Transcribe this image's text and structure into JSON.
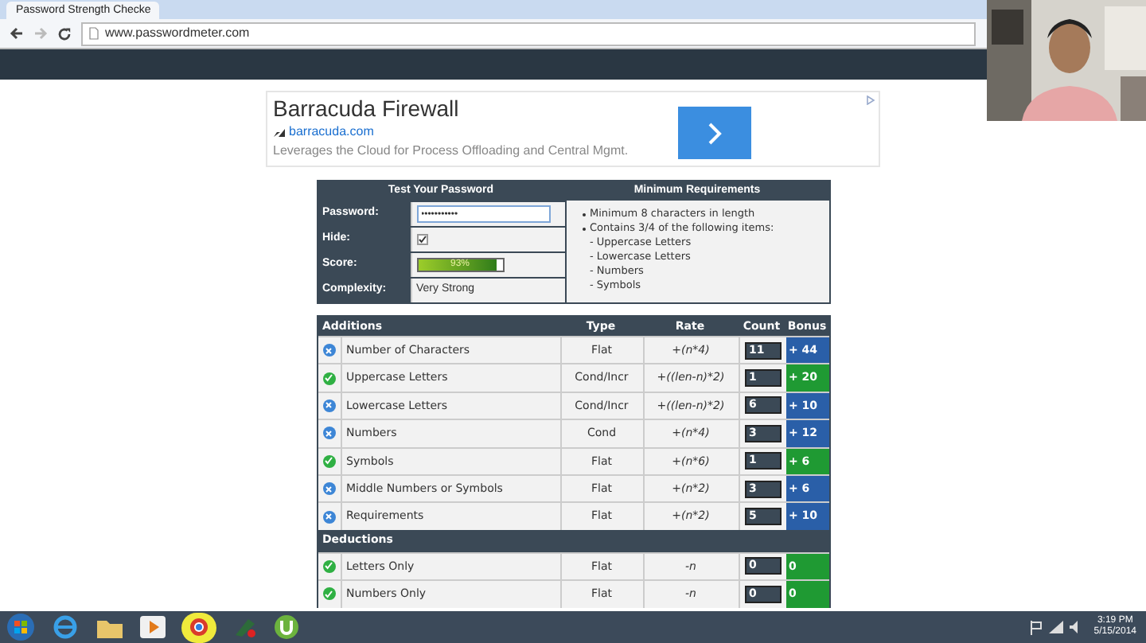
{
  "browser": {
    "tab_title": "Password Strength Checke",
    "url": "www.passwordmeter.com"
  },
  "ad": {
    "title": "Barracuda Firewall",
    "domain": "barracuda.com",
    "text": "Leverages the Cloud for Process Offloading and Central Mgmt."
  },
  "test_panel": {
    "title": "Test Your Password",
    "password_label": "Password:",
    "password_value": "•••••••••••",
    "hide_label": "Hide:",
    "hide_checked": true,
    "score_label": "Score:",
    "score_text": "93%",
    "level": 0.93,
    "complexity_label": "Complexity:",
    "complexity_value": "Very Strong"
  },
  "requirements": {
    "title": "Minimum Requirements",
    "items": [
      "Minimum 8 characters in length",
      "Contains 3/4 of the following items:"
    ],
    "sub_items": [
      "- Uppercase Letters",
      "- Lowercase Letters",
      "- Numbers",
      "- Symbols"
    ]
  },
  "table": {
    "columns": [
      "Additions",
      "Type",
      "Rate",
      "Count",
      "Bonus"
    ],
    "rows": [
      {
        "kind": "sufficient",
        "name": "Number of Characters",
        "type": "Flat",
        "rate": "+(n*4)",
        "count": "11",
        "bonus": "+ 44"
      },
      {
        "kind": "exceptional",
        "name": "Uppercase Letters",
        "type": "Cond/Incr",
        "rate": "+((len-n)*2)",
        "count": "1",
        "bonus": "+ 20"
      },
      {
        "kind": "sufficient",
        "name": "Lowercase Letters",
        "type": "Cond/Incr",
        "rate": "+((len-n)*2)",
        "count": "6",
        "bonus": "+ 10"
      },
      {
        "kind": "sufficient",
        "name": "Numbers",
        "type": "Cond",
        "rate": "+(n*4)",
        "count": "3",
        "bonus": "+ 12"
      },
      {
        "kind": "exceptional",
        "name": "Symbols",
        "type": "Flat",
        "rate": "+(n*6)",
        "count": "1",
        "bonus": "+ 6"
      },
      {
        "kind": "sufficient",
        "name": "Middle Numbers or Symbols",
        "type": "Flat",
        "rate": "+(n*2)",
        "count": "3",
        "bonus": "+ 6"
      },
      {
        "kind": "sufficient",
        "name": "Requirements",
        "type": "Flat",
        "rate": "+(n*2)",
        "count": "5",
        "bonus": "+ 10"
      }
    ],
    "deductions_title": "Deductions",
    "deductions": [
      {
        "kind": "exceptional",
        "name": "Letters Only",
        "type": "Flat",
        "rate": "-n",
        "count": "0",
        "bonus": "0"
      },
      {
        "kind": "exceptional",
        "name": "Numbers Only",
        "type": "Flat",
        "rate": "-n",
        "count": "0",
        "bonus": "0"
      }
    ]
  },
  "taskbar": {
    "time": "3:19 PM",
    "date": "5/15/2014"
  }
}
